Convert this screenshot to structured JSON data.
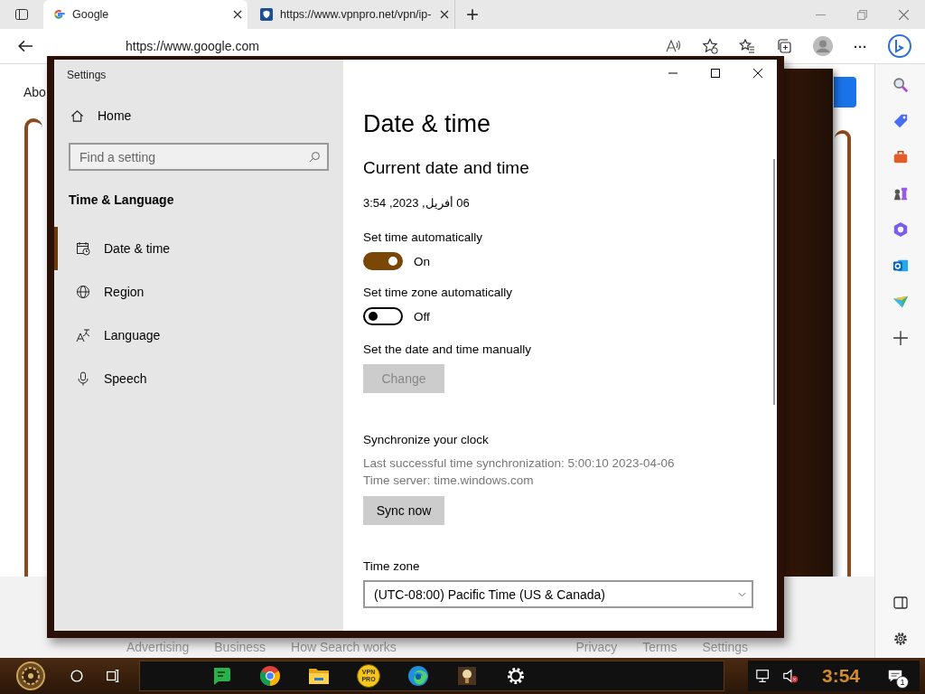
{
  "browser": {
    "tabs": [
      {
        "title": "Google",
        "selected": true
      },
      {
        "title": "https://www.vpnpro.net/vpn/ip-",
        "selected": false
      }
    ],
    "new_tab": "+",
    "address": "https://www.google.com",
    "more": "···",
    "page": {
      "corner_text": "Abo",
      "footer_left": [
        "Advertising",
        "Business",
        "How Search works"
      ],
      "footer_right": [
        "Privacy",
        "Terms",
        "Settings"
      ]
    }
  },
  "settings": {
    "title": "Settings",
    "home": "Home",
    "search": {
      "placeholder": "Find a setting"
    },
    "section": "Time & Language",
    "nav": [
      {
        "label": "Date & time",
        "selected": true
      },
      {
        "label": "Region",
        "selected": false
      },
      {
        "label": "Language",
        "selected": false
      },
      {
        "label": "Speech",
        "selected": false
      }
    ],
    "heading": "Date & time",
    "subheading": "Current date and time",
    "current": "06 أفريل, 2023, 3:54",
    "toggles": [
      {
        "label": "Set time automatically",
        "on": true,
        "state_text": "On"
      },
      {
        "label": "Set time zone automatically",
        "on": false,
        "state_text": "Off"
      }
    ],
    "manual": {
      "label": "Set the date and time manually",
      "button": "Change",
      "disabled": true
    },
    "sync": {
      "title": "Synchronize your clock",
      "lines": [
        "Last successful time synchronization: 5:00:10 2023-04-06",
        "Time server: time.windows.com"
      ],
      "button": "Sync now",
      "disabled": false
    },
    "timezone": {
      "label": "Time zone",
      "value": "(UTC-08:00) Pacific Time (US & Canada)"
    }
  },
  "taskbar": {
    "apps": [
      {
        "kind": "chat"
      },
      {
        "kind": "chrome"
      },
      {
        "kind": "folder"
      },
      {
        "kind": "vpn",
        "label": "VPN PRO"
      },
      {
        "kind": "edge"
      },
      {
        "kind": "app"
      },
      {
        "kind": "gear"
      }
    ],
    "clock": "3:54",
    "notifications": "1"
  }
}
